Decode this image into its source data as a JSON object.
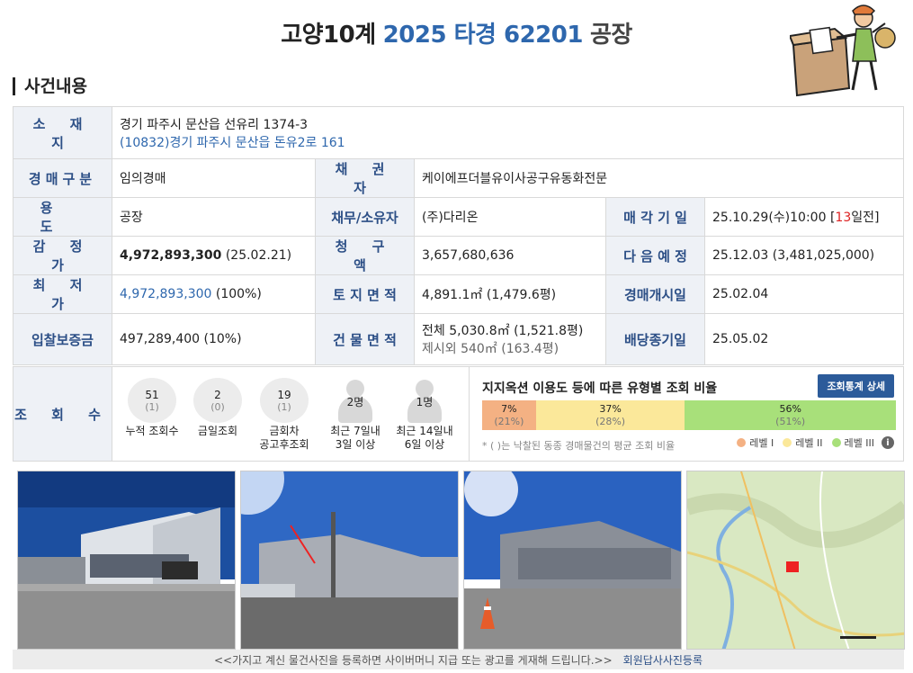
{
  "header": {
    "court": "고양10계",
    "case_no": "2025 타경 62201",
    "category": "공장"
  },
  "section_title": "사건내용",
  "info": {
    "location_label": "소 재 지",
    "location_addr": "경기 파주시 문산읍 선유리 1374-3",
    "location_road": "(10832)경기 파주시  문산읍 돈유2로  161",
    "type_label": "경매구분",
    "type_value": "임의경매",
    "creditor_label": "채 권 자",
    "creditor_value": "케이에프더블유이사공구유동화전문",
    "use_label": "용 도",
    "use_value": "공장",
    "debtor_label": "채무/소유자",
    "debtor_value": "(주)다리온",
    "sale_date_label": "매 각 기 일",
    "sale_date_value": "25.10.29(수)10:00 [",
    "sale_date_days": "13",
    "sale_date_suffix": "일전]",
    "appraisal_label": "감 정 가",
    "appraisal_value": "4,972,893,300",
    "appraisal_date": "(25.02.21)",
    "claim_label": "청 구 액",
    "claim_value": "3,657,680,636",
    "next_label": "다 음 예 정",
    "next_value": "25.12.03 (3,481,025,000)",
    "min_label": "최 저 가",
    "min_value": "4,972,893,300",
    "min_pct": "(100%)",
    "land_label": "토 지 면 적",
    "land_value": "4,891.1㎡ (1,479.6평)",
    "start_label": "경매개시일",
    "start_value": "25.02.04",
    "deposit_label": "입찰보증금",
    "deposit_value": "497,289,400 (10%)",
    "bldg_label": "건 물 면 적",
    "bldg_value": "전체 5,030.8㎡ (1,521.8평)",
    "bldg_extra": "제시외 540㎡ (163.4평)",
    "dividend_label": "배당종기일",
    "dividend_value": "25.05.02"
  },
  "stats": {
    "label": "조 회 수",
    "items": [
      {
        "num": "51",
        "sub": "(1)",
        "caption": "누적 조회수"
      },
      {
        "num": "2",
        "sub": "(0)",
        "caption": "금일조회"
      },
      {
        "num": "19",
        "sub": "(1)",
        "caption1": "금회차",
        "caption2": "공고후조회"
      },
      {
        "num": "2명",
        "caption1": "최근 7일내",
        "caption2": "3일 이상"
      },
      {
        "num": "1명",
        "caption1": "최근 14일내",
        "caption2": "6일 이상"
      }
    ],
    "ratio_title": "지지옥션 이용도 등에 따른 유형별 조회 비율",
    "detail_button": "조회통계 상세",
    "segments": [
      {
        "pct": "7%",
        "avg": "(21%)",
        "color": "#f4b183"
      },
      {
        "pct": "37%",
        "avg": "(28%)",
        "color": "#fbe89a"
      },
      {
        "pct": "56%",
        "avg": "(51%)",
        "color": "#a8e07a"
      }
    ],
    "segment_fractions": [
      0.13,
      0.36,
      0.51
    ],
    "note": "* ( )는 낙찰된 동종 경매물건의 평균 조회 비율",
    "legend": [
      "레벨 I",
      "레벨 II",
      "레벨 III"
    ]
  },
  "footer": {
    "notice": "<<가지고 계신 물건사진을 등록하면 사이버머니 지급 또는 광고를 게재해 드립니다.>>",
    "link": "회원답사사진등록"
  }
}
